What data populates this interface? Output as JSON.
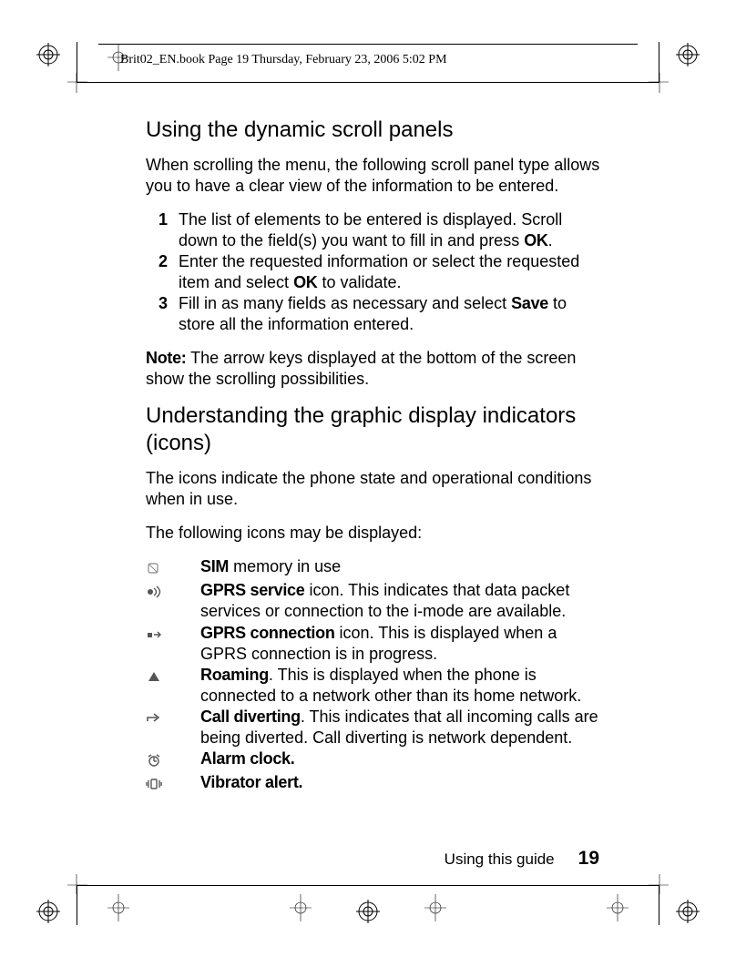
{
  "header": "Brit02_EN.book  Page 19  Thursday, February 23, 2006  5:02 PM",
  "section1": {
    "title": "Using the dynamic scroll panels",
    "intro": "When scrolling the menu, the following scroll panel type al­lows you to have a clear view of the information to be entered.",
    "steps": [
      {
        "pre": "The list of elements to be entered is displayed. Scroll down to the field(s) you want to fill in and press ",
        "b1": "OK",
        "post": "."
      },
      {
        "pre": "Enter the requested information or select the requested item and select ",
        "b1": "OK",
        "post": " to validate."
      },
      {
        "pre": "Fill in as many fields as necessary and select ",
        "b1": "Save",
        "post": " to store all the information entered."
      }
    ],
    "note_label": "Note:",
    "note_text": " The arrow keys displayed at the bottom of the screen show the scrolling possibilities."
  },
  "section2": {
    "title": "Understanding the graphic display indicators (icons)",
    "intro1": "The icons indicate the phone state and operational conditions when in use.",
    "intro2": "The following icons may be displayed:",
    "items": [
      {
        "icon": "sim",
        "b": "SIM",
        "text": " memory in use"
      },
      {
        "icon": "gprs-service",
        "b": "GPRS service",
        "text": " icon. This indicates that data packet services or connection to the i-mode are available."
      },
      {
        "icon": "gprs-connection",
        "b": "GPRS connection",
        "text": " icon. This is displayed when a GPRS connection is in progress."
      },
      {
        "icon": "roaming",
        "b": "Roaming",
        "text": ". This is displayed when the phone is connected to a network other than its home network."
      },
      {
        "icon": "divert",
        "b": "Call diverting",
        "text": ". This indicates that all incoming calls are being diverted. Call diverting is network dependent."
      },
      {
        "icon": "alarm",
        "b": "Alarm clock.",
        "text": ""
      },
      {
        "icon": "vibrate",
        "b": "Vibrator alert.",
        "text": ""
      }
    ]
  },
  "footer": {
    "section": "Using this guide",
    "page": "19"
  }
}
